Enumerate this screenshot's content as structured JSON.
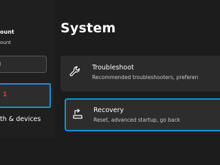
{
  "sidebar": {
    "account_name": "ount",
    "account_sub": "ount",
    "search_text": "l",
    "selected_marker": "1",
    "nav_item": "th & devices"
  },
  "main": {
    "title": "System",
    "cards": [
      {
        "title": "Troubleshoot",
        "description": "Recommended troubleshooters, preferen",
        "icon": "wrench-icon"
      },
      {
        "title": "Recovery",
        "description": "Reset, advanced startup, go back",
        "icon": "recovery-icon"
      }
    ]
  },
  "colors": {
    "background": "#1c1c1c",
    "card": "#2b2b2b",
    "highlight": "#1296d8",
    "marker": "#e53935"
  }
}
